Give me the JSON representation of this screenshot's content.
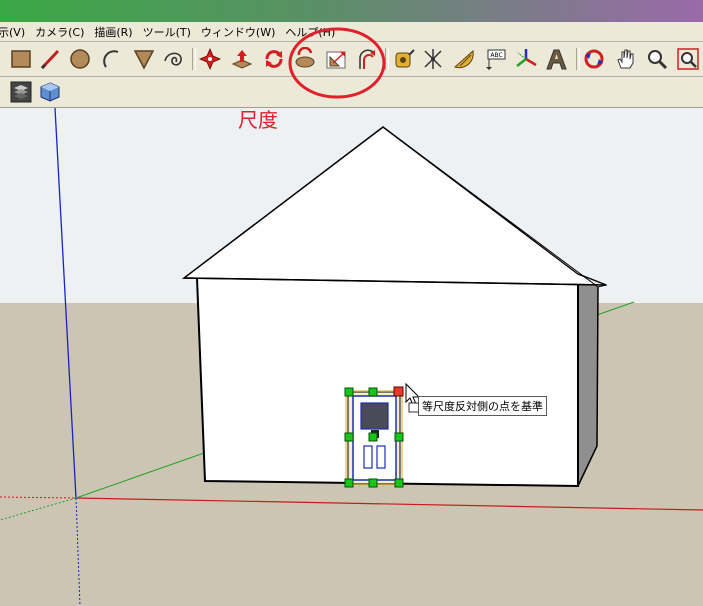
{
  "menu": {
    "items": [
      "示(V)",
      "カメラ(C)",
      "描画(R)",
      "ツール(T)",
      "ウィンドウ(W)",
      "ヘルプ(H)"
    ]
  },
  "toolbar": {
    "tools": [
      {
        "name": "select-tool-icon"
      },
      {
        "name": "pencil-tool-icon"
      },
      {
        "name": "circle-tool-icon"
      },
      {
        "name": "arc-tool-icon"
      },
      {
        "name": "paint-bucket-icon"
      },
      {
        "name": "eraser-icon"
      },
      {
        "name": "move-tool-icon"
      },
      {
        "name": "push-pull-icon"
      },
      {
        "name": "rotate-tool-icon"
      },
      {
        "name": "follow-me-icon"
      },
      {
        "name": "scale-tool-icon"
      },
      {
        "name": "offset-tool-icon"
      },
      {
        "name": "tape-measure-icon"
      },
      {
        "name": "dimension-icon"
      },
      {
        "name": "protractor-icon"
      },
      {
        "name": "text-label-icon"
      },
      {
        "name": "axes-icon"
      },
      {
        "name": "3d-text-icon"
      },
      {
        "name": "orbit-icon"
      },
      {
        "name": "pan-hand-icon"
      },
      {
        "name": "zoom-icon"
      },
      {
        "name": "zoom-window-icon"
      }
    ],
    "text_tool_label": "ABC"
  },
  "annotation": {
    "label": "尺度"
  },
  "tooltip": {
    "text": "等尺度反対側の点を基準"
  },
  "colors": {
    "highlight_circle": "#e0202a",
    "sky": "#eef1f3",
    "ground": "#ccc5b4",
    "handle_green": "#19c519",
    "handle_red": "#e53a2a",
    "selection_blue": "#1b2fb0"
  }
}
